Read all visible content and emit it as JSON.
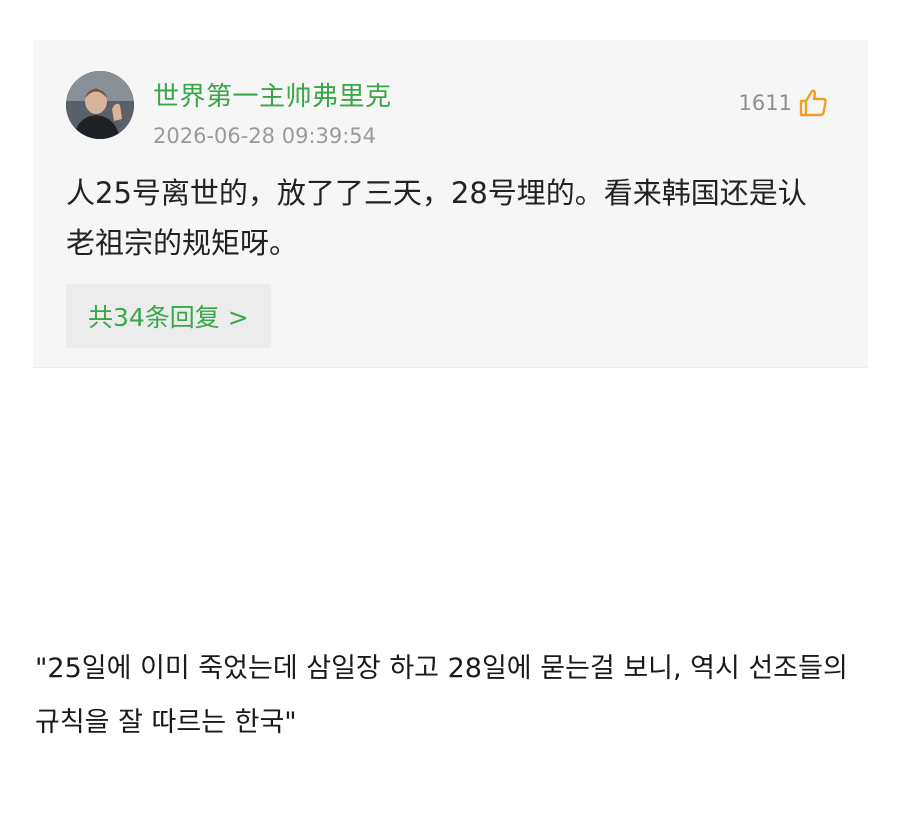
{
  "comment": {
    "username": "世界第一主帅弗里克",
    "timestamp": "2026-06-28 09:39:54",
    "like_count": "1611",
    "like_icon": "thumbs-up-icon",
    "text": "人25号离世的，放了了三天，28号埋的。看来韩国还是认老祖宗的规矩呀。",
    "replies_label": "共34条回复 >"
  },
  "translation": {
    "text": "\"25일에 이미 죽었는데 삼일장 하고 28일에 묻는걸 보니, 역시 선조들의 규칙을 잘 따르는 한국\""
  },
  "colors": {
    "accent_green": "#3aa64a",
    "card_background": "#f6f6f6",
    "muted_text": "#9a9a9a"
  }
}
